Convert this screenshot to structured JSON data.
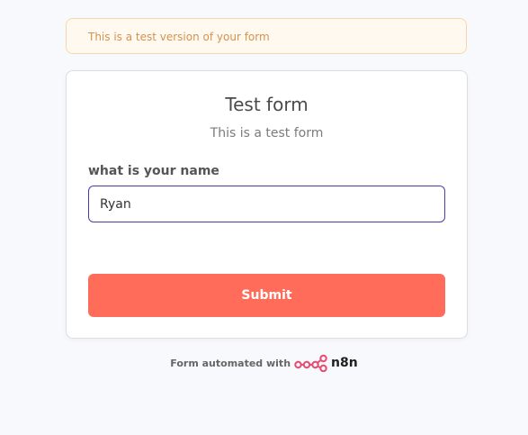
{
  "banner": {
    "text": "This is a test version of your form"
  },
  "form": {
    "title": "Test form",
    "subtitle": "This is a test form",
    "field_label": "what is your name",
    "field_value": "Ryan",
    "submit_label": "Submit"
  },
  "footer": {
    "text": "Form automated with",
    "brand": "n8n",
    "brand_icon": "n8n-logo-icon"
  },
  "colors": {
    "page_bg": "#f8f9fc",
    "banner_bg": "#fff9f0",
    "banner_border": "#f7d7a6",
    "banner_text": "#d5924e",
    "input_border": "#4b3da8",
    "submit_bg": "#ff6d5a",
    "brand_pink": "#ea4b71"
  }
}
